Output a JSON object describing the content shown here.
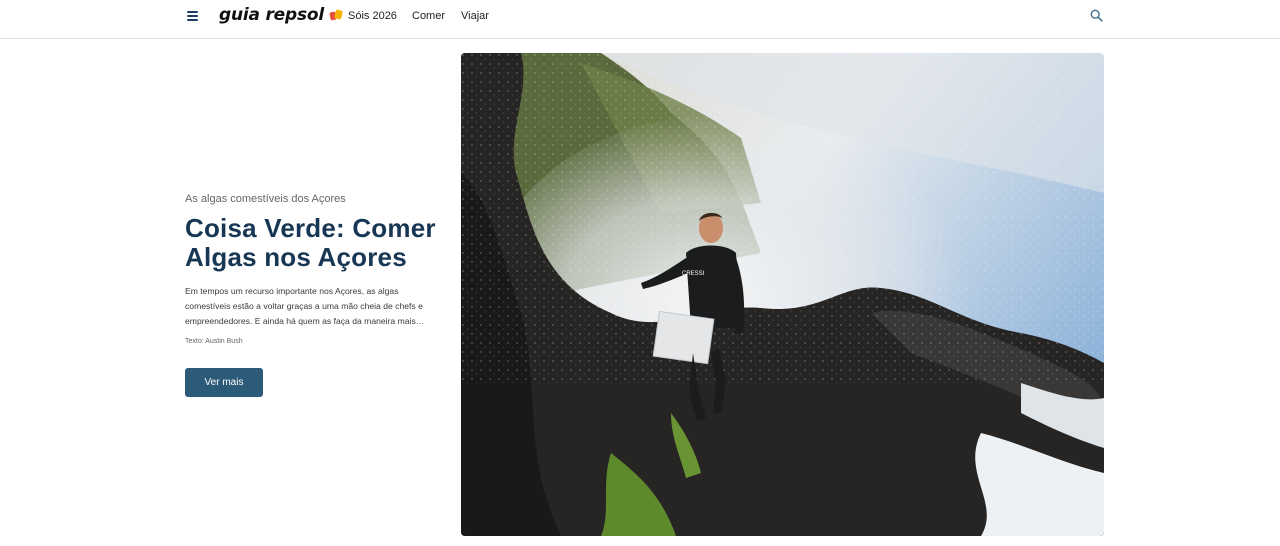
{
  "header": {
    "logo_text": "guia repsol",
    "nav": [
      {
        "label": "Sóis 2026",
        "icon": "sun-icon"
      },
      {
        "label": "Comer"
      },
      {
        "label": "Viajar"
      }
    ],
    "menu_icon": "hamburger-icon",
    "search_icon": "search-icon"
  },
  "article": {
    "eyebrow": "As algas comestíveis dos Açores",
    "title": "Coisa Verde: Comer Algas nos Açores",
    "description": "Em tempos um recurso importante nos Açores, as algas comestíveis estão a voltar graças a uma mão cheia de chefs e empreendedores. E ainda há quem as faça da maneira mais tradicional, a apanhar à mão nas rochas.",
    "author": "Texto: Austin Bush",
    "cta_label": "Ver mais",
    "image_subject": "Diver in a black wetsuit climbing dark volcanic rocks while a wave crashes",
    "wetsuit_brand": "CRESSI"
  },
  "colors": {
    "title": "#173754",
    "button": "#2b5b78",
    "menu_icon": "#1b3f66",
    "text": "#3a3a3a"
  }
}
